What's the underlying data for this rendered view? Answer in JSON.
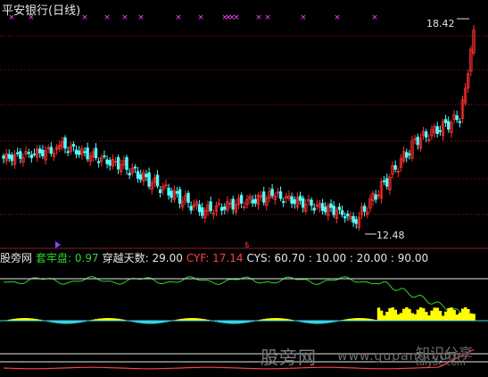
{
  "header": {
    "title": "平安银行(日线)"
  },
  "indicator_bar": {
    "source_label": "股旁网",
    "gauge_name": "套牢盘",
    "gauge_value": ": 0.97",
    "cross_name": "穿越天数",
    "cross_value": ": 29.00",
    "cyf_name": "CYF",
    "cyf_value": ": 17.14",
    "cys_name": "CYS",
    "cys_value": ": 60.70",
    "levels_text": ": 10.00 : 20.00 : 90.00"
  },
  "watermark": {
    "text_cn": "股旁网",
    "text_url": "www.gupang.com",
    "logo_cn": "知识分享",
    "logo_url": "taiyde.com"
  },
  "colors": {
    "up_candle": "#ff3030",
    "down_candle": "#54fcfc",
    "gridline": "#8b1a1a",
    "markers": "#ff44ff",
    "price_label": "#e0e0e0",
    "indicator_green": "#2fd22f",
    "indicator_white": "#e6e6e6",
    "indicator_red": "#ff4040",
    "histogram_yellow": "#ffff00",
    "histogram_cyan": "#36d3e6"
  },
  "chart_data": [
    {
      "type": "candlestick",
      "series": [
        {
          "name": "平安银行(日线)"
        }
      ],
      "annotations": [
        {
          "text": "18.42",
          "kind": "max_price"
        },
        {
          "text": "12.48",
          "kind": "min_price"
        }
      ],
      "ylim": [
        11.8,
        18.9
      ],
      "highest_marked": 18.42,
      "lowest_marked": 12.48,
      "pattern": [
        {
          "segment": "early rise",
          "from": 14.5,
          "to": 14.9
        },
        {
          "segment": "mid decline",
          "from": 14.9,
          "to": 12.9
        },
        {
          "segment": "sideways",
          "from": 12.9,
          "to": 13.3
        },
        {
          "segment": "late rally",
          "from": 12.5,
          "to": 18.4
        }
      ],
      "grid": true
    },
    {
      "type": "line",
      "series": [
        {
          "name": "套牢盘",
          "latest": 0.97
        },
        {
          "name": "穿越天数",
          "latest": 29.0
        },
        {
          "name": "CYF",
          "latest": 17.14
        },
        {
          "name": "CYS",
          "latest": 60.7
        }
      ],
      "reference_lines": [
        10.0,
        20.0,
        90.0
      ]
    }
  ]
}
